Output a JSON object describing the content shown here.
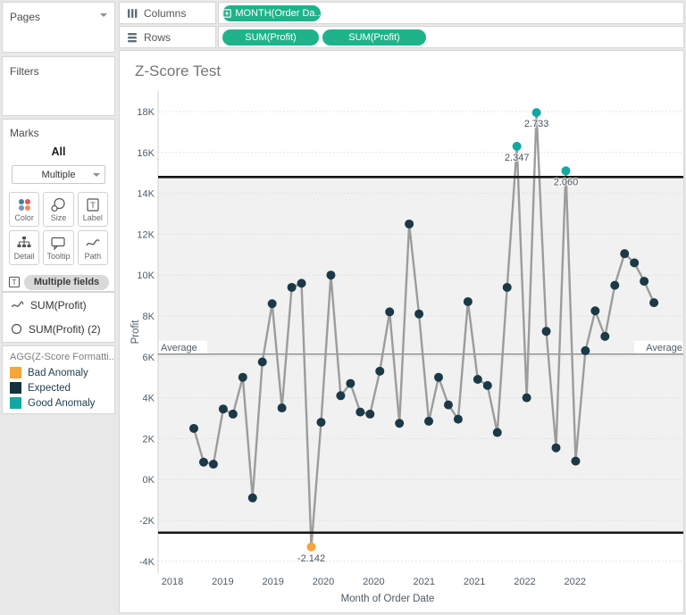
{
  "sidebar": {
    "pages_label": "Pages",
    "filters_label": "Filters",
    "marks_label": "Marks",
    "all_label": "All",
    "mark_type": "Multiple",
    "mark_buttons": [
      {
        "label": "Color",
        "icon": "color-icon"
      },
      {
        "label": "Size",
        "icon": "size-icon"
      },
      {
        "label": "Label",
        "icon": "label-icon"
      },
      {
        "label": "Detail",
        "icon": "detail-icon"
      },
      {
        "label": "Tooltip",
        "icon": "tooltip-icon"
      },
      {
        "label": "Path",
        "icon": "path-icon"
      }
    ],
    "target_pills": [
      {
        "icon": "text-icon",
        "label": "Multiple fields"
      },
      {
        "icon": "color-icon",
        "label": "Multiple fields"
      }
    ],
    "fields": [
      {
        "icon": "line-type-icon",
        "label": "SUM(Profit)"
      },
      {
        "icon": "circle-type-icon",
        "label": "SUM(Profit) (2)"
      }
    ]
  },
  "legend": {
    "title": "AGG(Z-Score Formatti...",
    "items": [
      {
        "label": "Bad Anomaly",
        "color": "#F5A53C"
      },
      {
        "label": "Expected",
        "color": "#15313D"
      },
      {
        "label": "Good Anomaly",
        "color": "#10A8A0"
      }
    ]
  },
  "shelves": {
    "columns_label": "Columns",
    "rows_label": "Rows",
    "columns_pills": [
      {
        "label": "MONTH(Order Da..",
        "icon": "plus-box-icon"
      }
    ],
    "rows_pills": [
      {
        "label": "SUM(Profit)"
      },
      {
        "label": "SUM(Profit)"
      }
    ],
    "pill_color": "#1EB38B"
  },
  "chart_data": {
    "type": "line",
    "title": "Z-Score Test",
    "xlabel": "Month of Order Date",
    "ylabel": "Profit",
    "ylim": [
      -4000,
      18000
    ],
    "grid": "horizontal-dotted",
    "x_tick_labels": [
      "2018",
      "2019",
      "2019",
      "2020",
      "2020",
      "2021",
      "2021",
      "2022",
      "2022"
    ],
    "y_ticks": [
      {
        "value": 18000,
        "label": "18K"
      },
      {
        "value": 16000,
        "label": "16K"
      },
      {
        "value": 14000,
        "label": "14K"
      },
      {
        "value": 12000,
        "label": "12K"
      },
      {
        "value": 10000,
        "label": "10K"
      },
      {
        "value": 8000,
        "label": "8K"
      },
      {
        "value": 6000,
        "label": "6K"
      },
      {
        "value": 4000,
        "label": "4K"
      },
      {
        "value": 2000,
        "label": "2K"
      },
      {
        "value": 0,
        "label": "0K"
      },
      {
        "value": -2000,
        "label": "-2K"
      },
      {
        "value": -4000,
        "label": "-4K"
      }
    ],
    "values": [
      2500,
      850,
      750,
      3450,
      3200,
      5000,
      -900,
      5750,
      8600,
      3500,
      9400,
      9600,
      -3300,
      2800,
      10000,
      4100,
      4700,
      3300,
      3200,
      5300,
      8200,
      2750,
      12500,
      8100,
      2850,
      5000,
      3650,
      2950,
      8700,
      4900,
      4600,
      2300,
      9400,
      16300,
      4000,
      17950,
      7250,
      1550,
      15100,
      900,
      6300,
      8250,
      7000,
      9500,
      11050,
      10600,
      9700,
      8650
    ],
    "reference_lines": {
      "upper": 14800,
      "lower": -2600
    },
    "average": {
      "value": 6130,
      "label": "Average"
    },
    "annotations": [
      {
        "point_index": 12,
        "text": "-2.142",
        "role": "bad"
      },
      {
        "point_index": 33,
        "text": "2.347",
        "role": "good"
      },
      {
        "point_index": 35,
        "text": "2.733",
        "role": "good"
      },
      {
        "point_index": 38,
        "text": "2.060",
        "role": "good"
      }
    ],
    "colors": {
      "line": "#9c9c9c",
      "expected": "#1b3947",
      "good": "#12A8A1",
      "bad": "#F6A53C",
      "reference": "#151515",
      "average_line": "#6b7478",
      "grid": "#dcdcdc",
      "band": "#f1f1f1",
      "axis_line": "#d0d0d0"
    }
  }
}
